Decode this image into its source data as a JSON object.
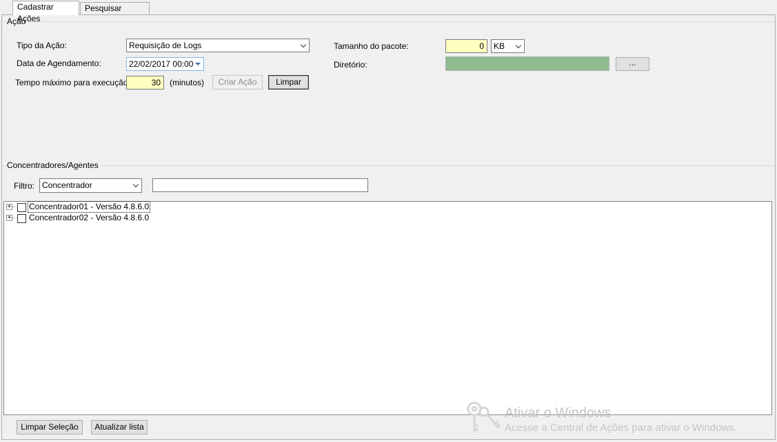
{
  "tabs": [
    {
      "label": "Cadastrar Ações",
      "active": true
    },
    {
      "label": "Pesquisar Ações",
      "active": false
    }
  ],
  "acao": {
    "group_title": "Ação",
    "tipo_label": "Tipo da Ação:",
    "tipo_value": "Requisição de Logs",
    "data_label": "Data de Agendamento:",
    "data_value": "22/02/2017 00:00",
    "tempo_label": "Tempo máximo para execução:",
    "tempo_value": "30",
    "tempo_unit": "(minutos)",
    "criar_button": "Criar Ação",
    "limpar_button": "Limpar",
    "tamanho_label": "Tamanho do pacote:",
    "tamanho_value": "0",
    "tamanho_unit": "KB",
    "diretorio_label": "Diretório:",
    "diretorio_value": "",
    "browse_button": "..."
  },
  "concentradores": {
    "group_title": "Concentradores/Agentes",
    "filtro_label": "Filtro:",
    "filtro_value": "Concentrador",
    "filtro_text": "",
    "items": [
      {
        "name": "Concentrador01",
        "version": " - Versão 4.8.6.0",
        "label": "Concentrador01  - Versão 4.8.6.0",
        "checked": false
      },
      {
        "name": "Concentrador02",
        "version": " - Versão 4.8.6.0",
        "label": "Concentrador02  - Versão 4.8.6.0",
        "checked": false
      }
    ]
  },
  "footer": {
    "limpar_selecao_button": "Limpar Seleção",
    "atualizar_lista_button": "Atualizar lista"
  },
  "watermark": {
    "title": "Ativar o Windows",
    "subtitle": "Acesse a Central de Ações para ativar o Windows."
  },
  "colors": {
    "yellow_field": "#ffffc0",
    "diretorio_field": "#8fbc8f"
  }
}
